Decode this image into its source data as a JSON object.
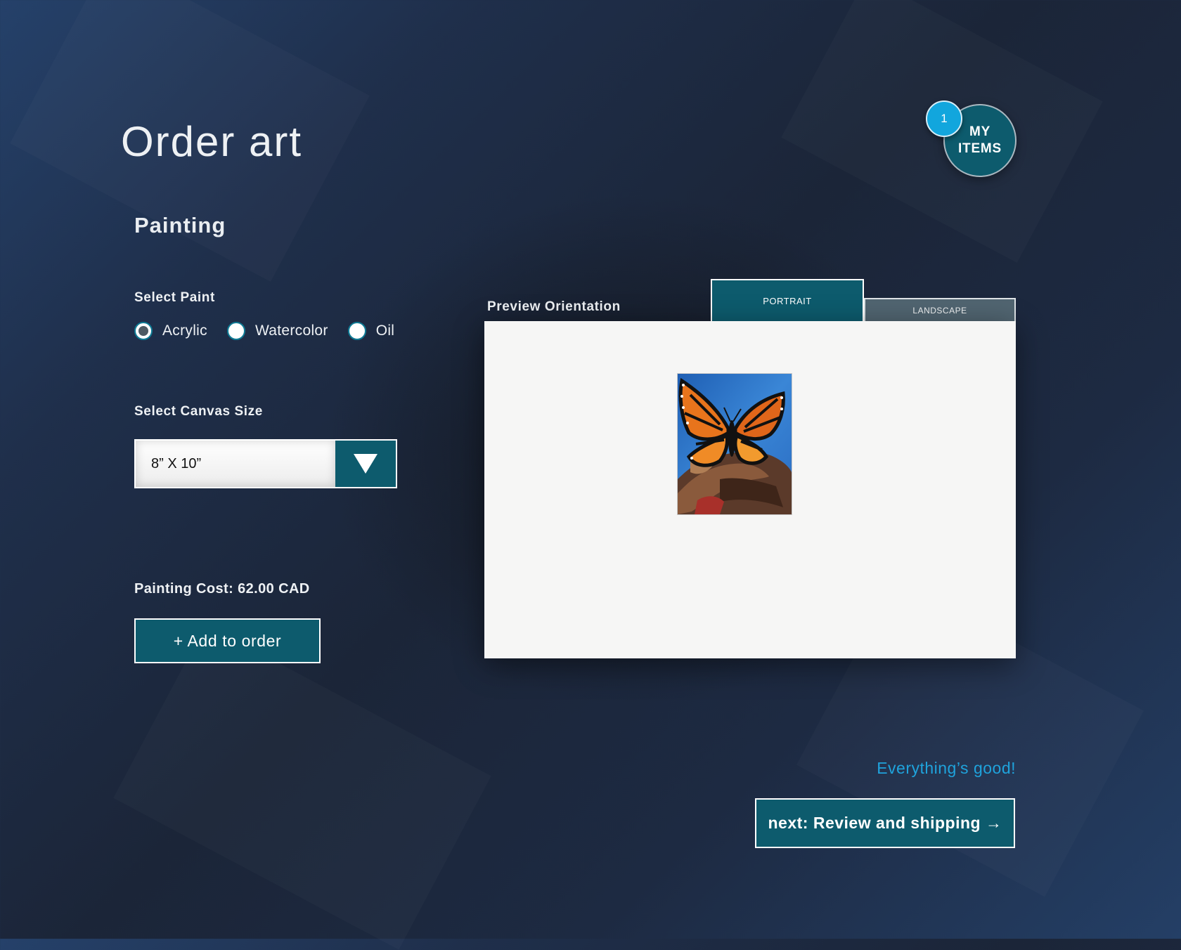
{
  "header": {
    "title": "Order art"
  },
  "my_items": {
    "label_line1": "MY",
    "label_line2": "ITEMS",
    "count": "1"
  },
  "section": {
    "title": "Painting"
  },
  "paint": {
    "label": "Select Paint",
    "options": [
      {
        "label": "Acrylic",
        "selected": true
      },
      {
        "label": "Watercolor",
        "selected": false
      },
      {
        "label": "Oil",
        "selected": false
      }
    ]
  },
  "canvas_size": {
    "label": "Select Canvas Size",
    "value": "8” X 10”"
  },
  "cost": {
    "text": "Painting Cost: 62.00 CAD"
  },
  "actions": {
    "add_label": "+ Add to order",
    "next_label": "next: Review and shipping →"
  },
  "preview": {
    "label": "Preview Orientation",
    "tabs": [
      {
        "label": "PORTRAIT",
        "active": true
      },
      {
        "label": "LANDSCAPE",
        "active": false
      }
    ]
  },
  "status": {
    "text": "Everything’s good!",
    "color": "#1fa3dc"
  },
  "colors": {
    "accent": "#0d5b6d",
    "badge": "#12a6dd"
  }
}
